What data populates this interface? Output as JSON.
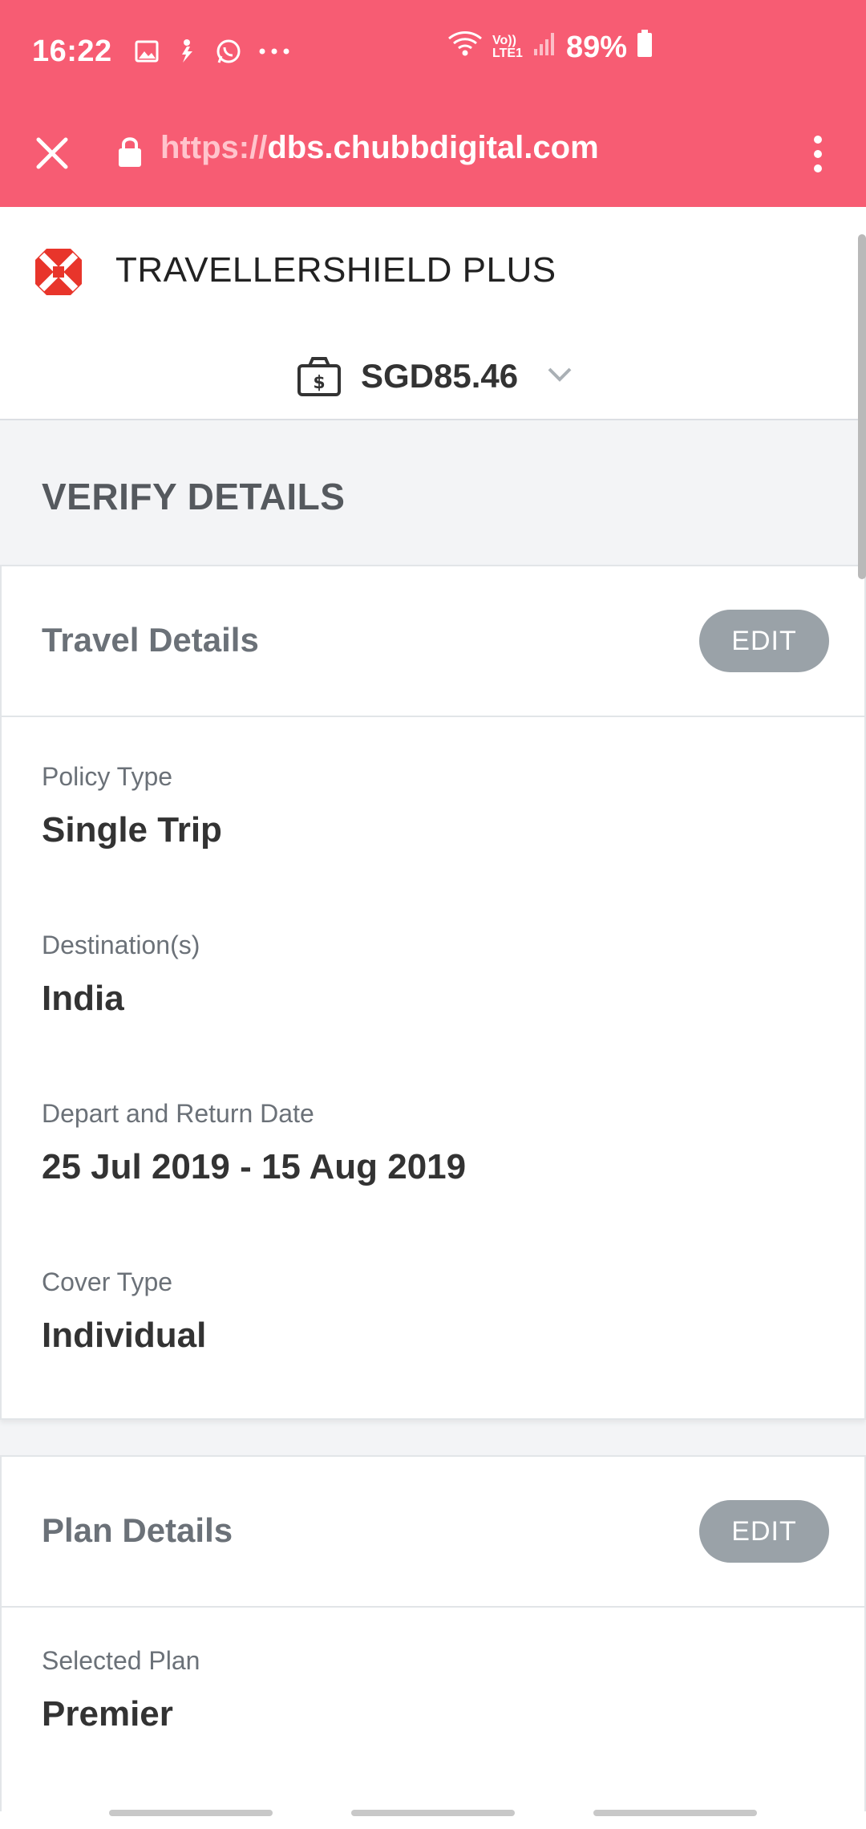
{
  "status_bar": {
    "time": "16:22",
    "network_label": "Vo)) LTE1",
    "battery": "89%",
    "icons": [
      "gallery-icon",
      "accessibility-icon",
      "whatsapp-icon",
      "more-dots-icon",
      "wifi-icon",
      "signal-icon",
      "battery-icon"
    ]
  },
  "browser": {
    "url_scheme": "https://",
    "url_host": "dbs.chubbdigital.com",
    "accent_color": "#f75c73"
  },
  "header": {
    "product_title": "TRAVELLERSHIELD PLUS",
    "price": "SGD85.46"
  },
  "page": {
    "section_title": "VERIFY DETAILS"
  },
  "travel_details": {
    "title": "Travel Details",
    "edit_label": "EDIT",
    "fields": [
      {
        "label": "Policy Type",
        "value": "Single Trip"
      },
      {
        "label": "Destination(s)",
        "value": "India"
      },
      {
        "label": "Depart and Return Date",
        "value": "25 Jul 2019 - 15 Aug 2019"
      },
      {
        "label": "Cover Type",
        "value": "Individual"
      }
    ]
  },
  "plan_details": {
    "title": "Plan Details",
    "edit_label": "EDIT",
    "fields": [
      {
        "label": "Selected Plan",
        "value": "Premier"
      }
    ]
  }
}
